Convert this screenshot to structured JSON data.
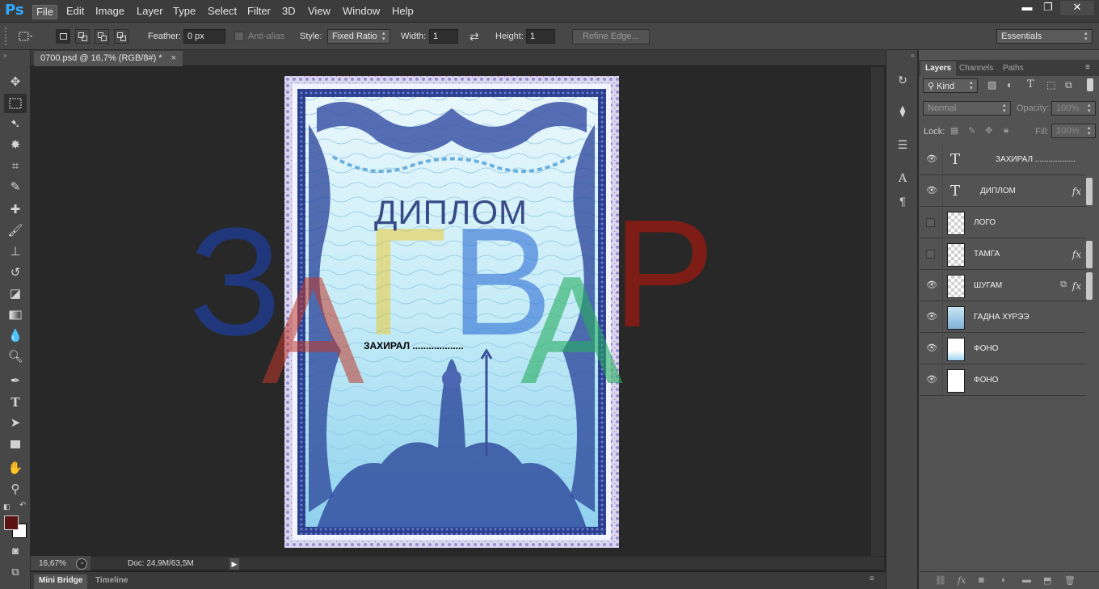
{
  "app": {
    "logo": "Ps",
    "menu": [
      "File",
      "Edit",
      "Image",
      "Layer",
      "Type",
      "Select",
      "Filter",
      "3D",
      "View",
      "Window",
      "Help"
    ],
    "window_buttons": [
      "▬",
      "❐",
      "✕"
    ]
  },
  "options_bar": {
    "feather_label": "Feather:",
    "feather_value": "0 px",
    "antialias_label": "Anti-alias",
    "style_label": "Style:",
    "style_value": "Fixed Ratio",
    "width_label": "Width:",
    "width_value": "1",
    "height_label": "Height:",
    "height_value": "1",
    "refine_edge": "Refine Edge...",
    "workspace": "Essentials"
  },
  "document": {
    "tab_title": "0700.psd @ 16,7% (RGB/8#) *",
    "tab_close": "×",
    "zoom": "16,67%",
    "doc_size": "Doc: 24,9M/63,5M"
  },
  "diploma": {
    "title": "ДИПЛОМ",
    "director_line": "ЗАХИРАЛ ...................",
    "watermark_letters": [
      {
        "char": "З",
        "color": "#1f3a8a"
      },
      {
        "char": "А",
        "color": "#c0392b"
      },
      {
        "char": "Г",
        "color": "#f1c40f"
      },
      {
        "char": "В",
        "color": "#2f6fd6"
      },
      {
        "char": "А",
        "color": "#27ae60"
      },
      {
        "char": "Р",
        "color": "#8e1c12"
      }
    ]
  },
  "bottom_tabs": [
    "Mini Bridge",
    "Timeline"
  ],
  "layers_panel": {
    "tabs": [
      "Layers",
      "Channels",
      "Paths"
    ],
    "filter_kind": "Kind",
    "blend_mode": "Normal",
    "opacity_label": "Opacity:",
    "opacity_value": "100%",
    "lock_label": "Lock:",
    "fill_label": "Fill:",
    "fill_value": "100%",
    "layers": [
      {
        "name": "ЗАХИРАЛ ..................",
        "type": "text",
        "visible": true,
        "fx": false
      },
      {
        "name": "ДИПЛОМ",
        "type": "text",
        "visible": true,
        "fx": true
      },
      {
        "name": "ЛОГО",
        "type": "raster",
        "visible": false,
        "fx": false
      },
      {
        "name": "ТАМГА",
        "type": "raster",
        "visible": false,
        "fx": true
      },
      {
        "name": "ШУГАМ",
        "type": "raster",
        "visible": true,
        "fx": true
      },
      {
        "name": "ГАДНА ХҮРЭЭ",
        "type": "frame",
        "visible": true,
        "fx": false
      },
      {
        "name": "ФОНО",
        "type": "gradient",
        "visible": true,
        "fx": false
      },
      {
        "name": "ФОНО",
        "type": "white",
        "visible": true,
        "fx": false
      }
    ]
  },
  "colors": {
    "foreground": "#5a1414",
    "background": "#ffffff",
    "accent": "#31a8ff"
  }
}
